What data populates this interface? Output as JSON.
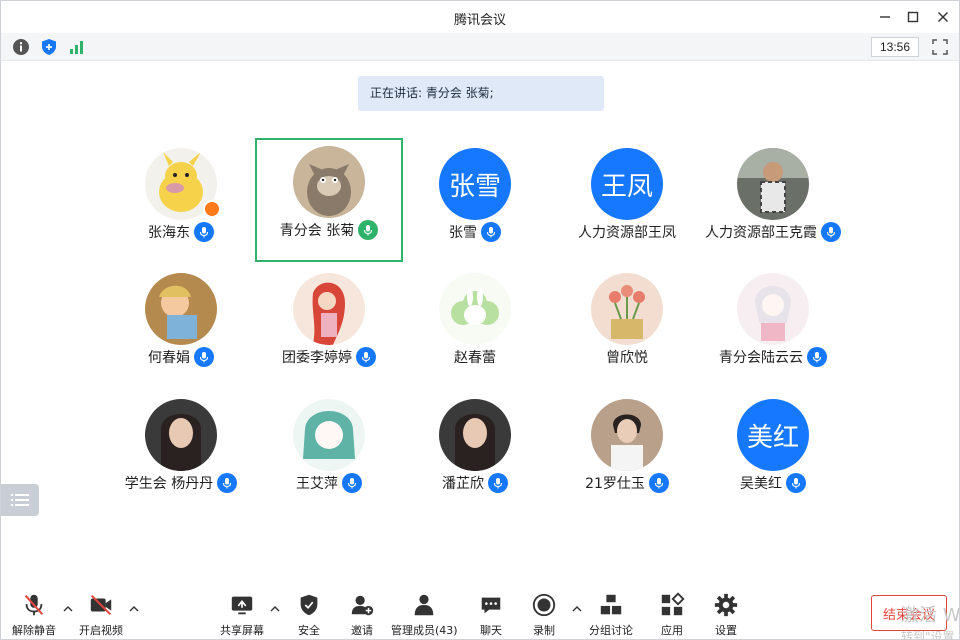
{
  "window": {
    "title": "腾讯会议"
  },
  "infobar": {
    "clock": "13:56"
  },
  "speaking": {
    "text": "正在讲话: 青分会 张菊;"
  },
  "participants": [
    {
      "name": "张海东",
      "avatar": "pikachu-avatar",
      "avatar_text": "",
      "mic": "muted",
      "host": true
    },
    {
      "name": "青分会 张菊",
      "avatar": "tom-cat-avatar",
      "avatar_text": "",
      "mic": "speaking",
      "active": true
    },
    {
      "name": "张雪",
      "avatar": "text-avatar",
      "avatar_text": "张雪",
      "mic": "muted"
    },
    {
      "name": "人力资源部王凤",
      "avatar": "text-avatar",
      "avatar_text": "王凤",
      "mic": ""
    },
    {
      "name": "人力资源部王克霞",
      "avatar": "photo-avatar",
      "avatar_text": "",
      "mic": "muted"
    },
    {
      "name": "何春娟",
      "avatar": "cartoon-avatar",
      "avatar_text": "",
      "mic": "muted"
    },
    {
      "name": "团委李婷婷",
      "avatar": "mermaid-avatar",
      "avatar_text": "",
      "mic": "muted"
    },
    {
      "name": "赵春蕾",
      "avatar": "bunny-avatar",
      "avatar_text": "",
      "mic": ""
    },
    {
      "name": "曾欣悦",
      "avatar": "tulips-avatar",
      "avatar_text": "",
      "mic": ""
    },
    {
      "name": "青分会陆云云",
      "avatar": "anime-girl-avatar",
      "avatar_text": "",
      "mic": "muted"
    },
    {
      "name": "学生会 杨丹丹",
      "avatar": "girl-photo-avatar",
      "avatar_text": "",
      "mic": "muted"
    },
    {
      "name": "王艾萍",
      "avatar": "anime-avatar",
      "avatar_text": "",
      "mic": "muted"
    },
    {
      "name": "潘芷欣",
      "avatar": "girl-photo-avatar",
      "avatar_text": "",
      "mic": "muted"
    },
    {
      "name": "21罗仕玉",
      "avatar": "boy-photo-avatar",
      "avatar_text": "",
      "mic": "muted"
    },
    {
      "name": "吴美红",
      "avatar": "text-avatar",
      "avatar_text": "美红",
      "mic": "muted"
    }
  ],
  "toolbar": {
    "unmute": "解除静音",
    "video": "开启视频",
    "share": "共享屏幕",
    "security": "安全",
    "invite": "邀请",
    "members": "管理成员(43)",
    "chat": "聊天",
    "record": "录制",
    "breakout": "分组讨论",
    "apps": "应用",
    "settings": "设置",
    "end": "结束会议"
  },
  "watermark": {
    "line1": "激活 W",
    "line2": "转到\"设置"
  },
  "colors": {
    "accent": "#1677ff",
    "speaking": "#2fb36a",
    "end": "#e2453c",
    "host": "#ff7a1a"
  }
}
